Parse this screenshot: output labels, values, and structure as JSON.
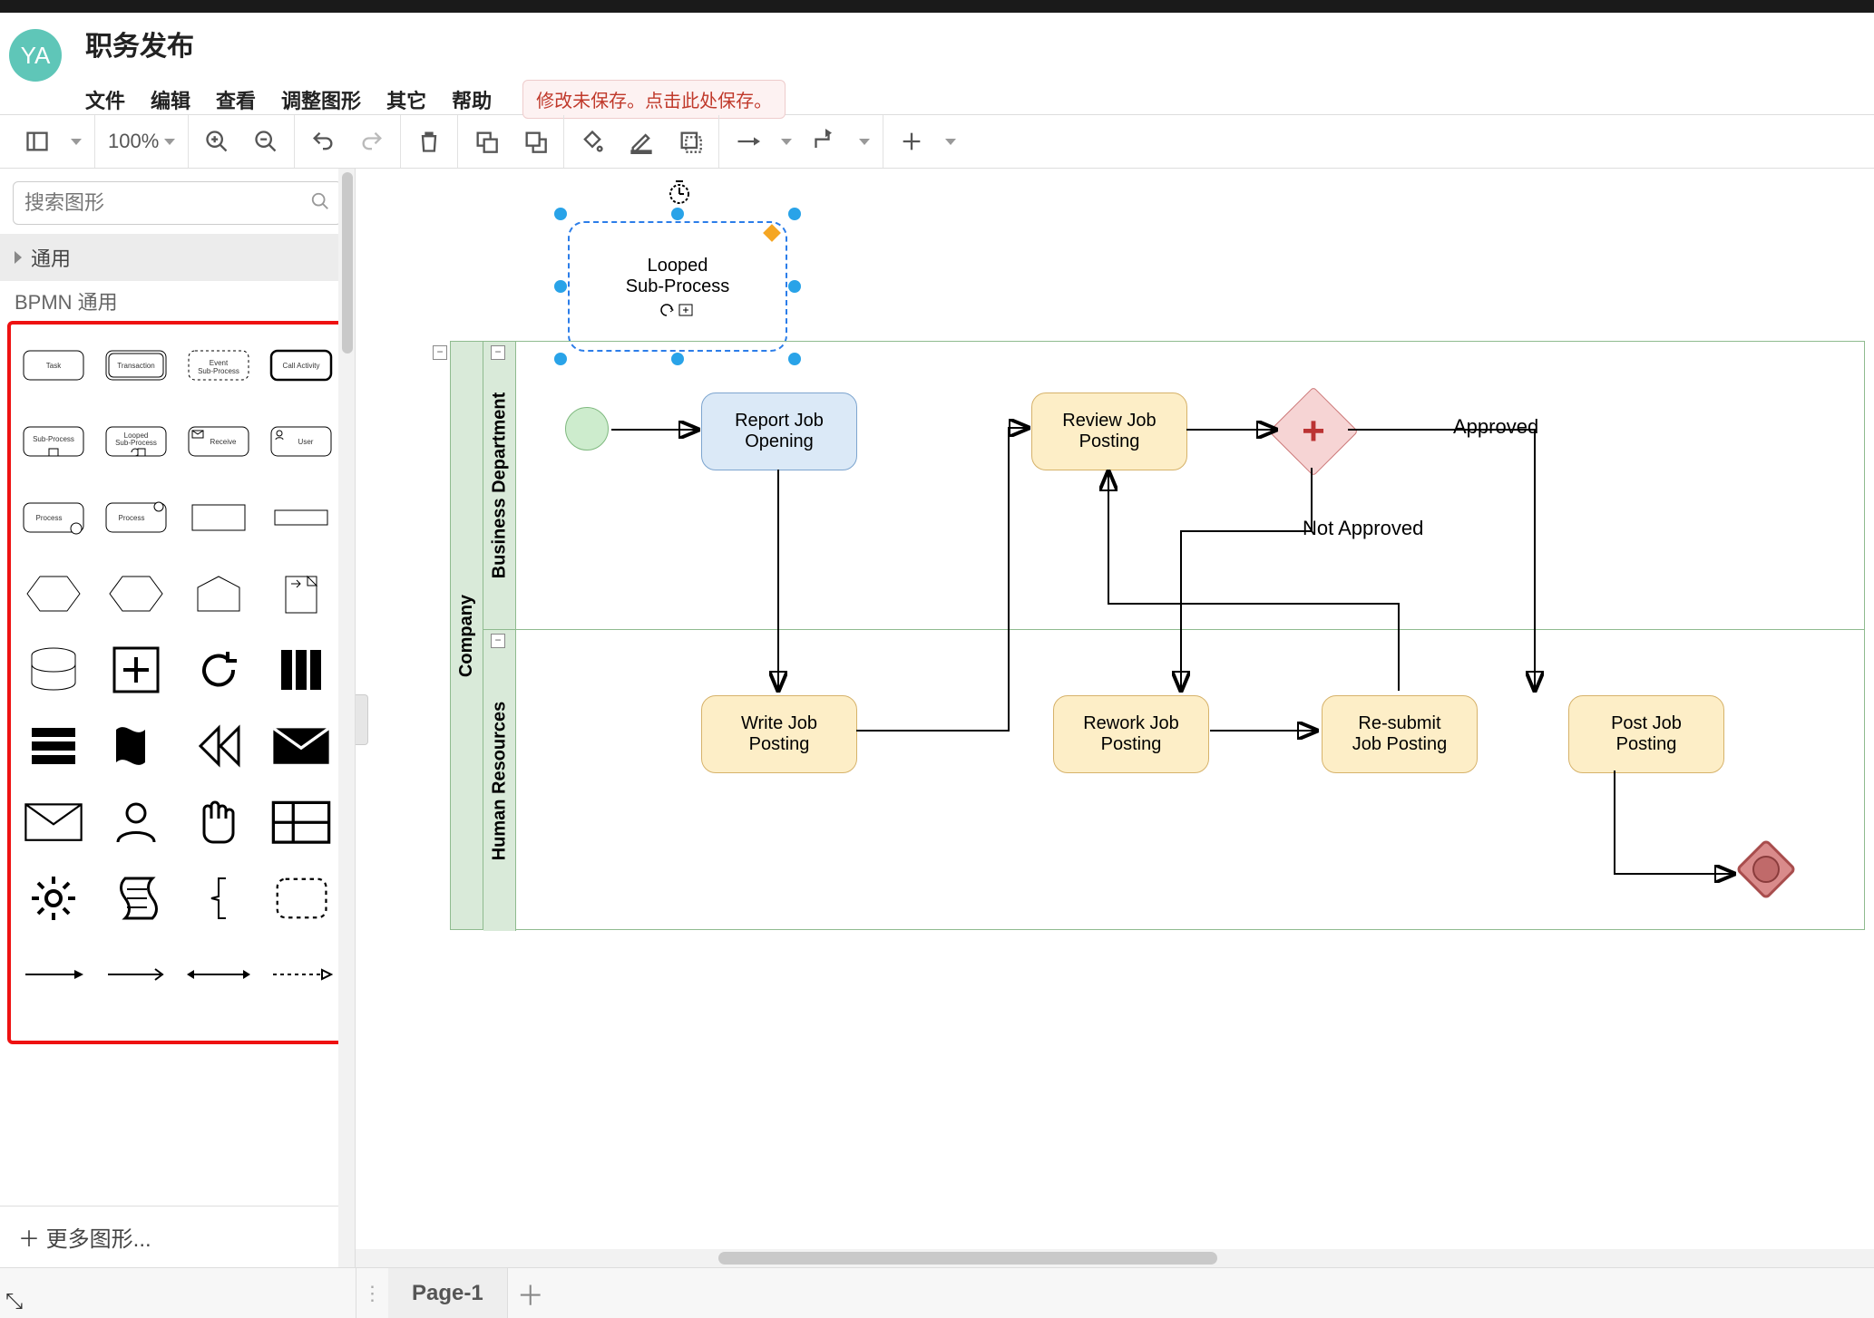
{
  "avatar_initials": "YA",
  "app_title": "职务发布",
  "menu": {
    "file": "文件",
    "edit": "编辑",
    "view": "查看",
    "arrange": "调整图形",
    "extras": "其它",
    "help": "帮助"
  },
  "save_warning": "修改未保存。点击此处保存。",
  "zoom": "100%",
  "search_placeholder": "搜索图形",
  "palette": {
    "general": "通用",
    "bpmn": "BPMN 通用"
  },
  "shape_labels": {
    "task": "Task",
    "transaction": "Transaction",
    "event_sub": "Event\nSub-Process",
    "call": "Call Activity",
    "sub": "Sub-Process",
    "looped": "Looped\nSub-Process",
    "receive": "Receive",
    "user": "User",
    "process1": "Process",
    "process2": "Process"
  },
  "more_shapes": "＋ 更多图形...",
  "diagram": {
    "pool": "Company",
    "lane1": "Business Department",
    "lane2": "Human Resources",
    "selected": {
      "l1": "Looped",
      "l2": "Sub-Process"
    },
    "tasks": {
      "report": "Report Job\nOpening",
      "review": "Review Job\nPosting",
      "write": "Write Job\nPosting",
      "rework": "Rework Job\nPosting",
      "resubmit": "Re-submit\nJob Posting",
      "post": "Post Job\nPosting"
    },
    "labels": {
      "approved": "Approved",
      "not_approved": "Not Approved"
    }
  },
  "page_tab": "Page-1",
  "chart_data": {
    "type": "bpmn",
    "pool": "Company",
    "lanes": [
      "Business Department",
      "Human Resources"
    ],
    "floating": {
      "id": "looped_sub",
      "type": "looped-sub-process",
      "label": "Looped Sub-Process",
      "selected": true
    },
    "nodes": [
      {
        "id": "start",
        "type": "start-event",
        "lane": 0
      },
      {
        "id": "report",
        "type": "task",
        "lane": 0,
        "label": "Report Job Opening"
      },
      {
        "id": "review",
        "type": "task",
        "lane": 0,
        "label": "Review Job Posting"
      },
      {
        "id": "gw",
        "type": "parallel-gateway",
        "lane": 0
      },
      {
        "id": "write",
        "type": "task",
        "lane": 1,
        "label": "Write Job Posting"
      },
      {
        "id": "rework",
        "type": "task",
        "lane": 1,
        "label": "Rework Job Posting"
      },
      {
        "id": "resubmit",
        "type": "task",
        "lane": 1,
        "label": "Re-submit Job Posting"
      },
      {
        "id": "post",
        "type": "task",
        "lane": 1,
        "label": "Post Job Posting"
      },
      {
        "id": "end",
        "type": "end-event",
        "lane": 1
      }
    ],
    "edges": [
      {
        "from": "start",
        "to": "report"
      },
      {
        "from": "report",
        "to": "write"
      },
      {
        "from": "write",
        "to": "review"
      },
      {
        "from": "review",
        "to": "gw"
      },
      {
        "from": "gw",
        "to": "post",
        "label": "Approved"
      },
      {
        "from": "gw",
        "to": "rework",
        "label": "Not Approved"
      },
      {
        "from": "rework",
        "to": "resubmit"
      },
      {
        "from": "resubmit",
        "to": "review"
      },
      {
        "from": "post",
        "to": "end"
      }
    ]
  }
}
